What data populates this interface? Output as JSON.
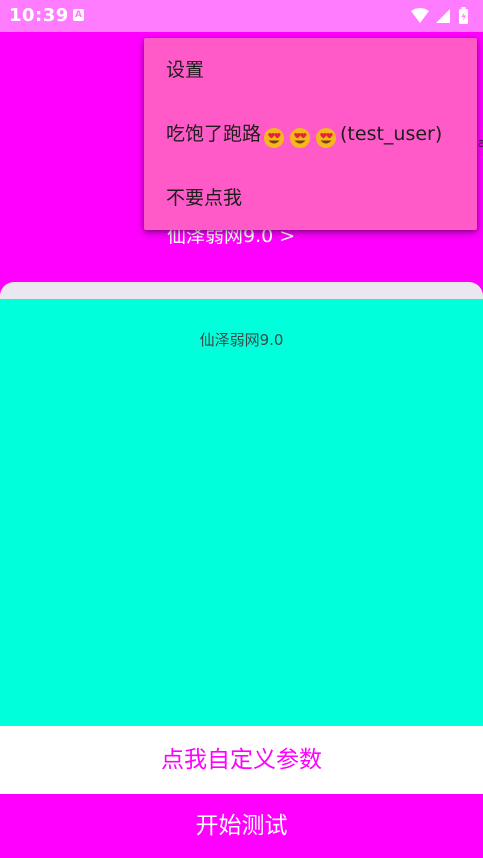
{
  "status_bar": {
    "time": "10:39",
    "notification_glyph": "A",
    "icons": [
      "wifi-icon",
      "signal-icon",
      "battery-icon"
    ]
  },
  "header": {
    "link_text": "仙泽弱网9.0 >"
  },
  "card": {
    "subtitle": "仙泽弱网9.0"
  },
  "buttons": {
    "custom_params": "点我自定义参数",
    "start_test": "开始测试"
  },
  "menu": {
    "items": [
      {
        "label": "设置"
      },
      {
        "label_prefix": "吃饱了跑路",
        "emoji": "heart-eyes-face-icon",
        "emoji_count": 3,
        "label_suffix": "(test_user)"
      },
      {
        "label": "不要点我"
      }
    ]
  },
  "colors": {
    "status_bar": "#ff7cff",
    "primary": "#ff00ff",
    "menu": "#ff5ac8",
    "card": "#00ffdb",
    "card_top": "#ebe7ee"
  }
}
